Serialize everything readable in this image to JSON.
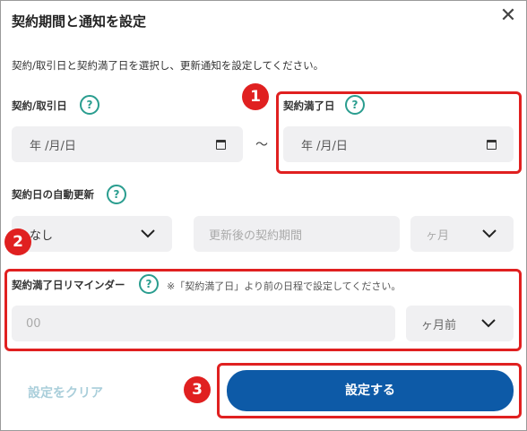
{
  "dialog": {
    "title": "契約期間と通知を設定",
    "description": "契約/取引日と契約満了日を選択し、更新通知を設定してください。"
  },
  "contract_start": {
    "label": "契約/取引日",
    "help": "?",
    "date_placeholder": "年 /月/日"
  },
  "range_separator": "～",
  "contract_end": {
    "label": "契約満了日",
    "help": "?",
    "date_placeholder": "年 /月/日"
  },
  "auto_renewal": {
    "label": "契約日の自動更新",
    "help": "?",
    "select_value": "なし",
    "period_placeholder": "更新後の契約期間",
    "unit_value": "ヶ月"
  },
  "reminder": {
    "label": "契約満了日リマインダー",
    "help": "?",
    "note": "※「契約満了日」より前の日程で設定してください。",
    "input_placeholder": "00",
    "unit_value": "ヶ月前"
  },
  "footer": {
    "clear_label": "設定をクリア",
    "submit_label": "設定する"
  },
  "annotations": {
    "badge_1": "1",
    "badge_2": "2",
    "badge_3": "3"
  },
  "colors": {
    "accent": "#0d5aa7",
    "help_icon": "#2a9d8f",
    "annotation": "#e02020",
    "field_bg": "#f0f0f2"
  },
  "icons": {
    "close": "close-icon",
    "help": "help-circle-icon",
    "calendar": "calendar-icon",
    "dropdown": "chevron-down-icon"
  }
}
